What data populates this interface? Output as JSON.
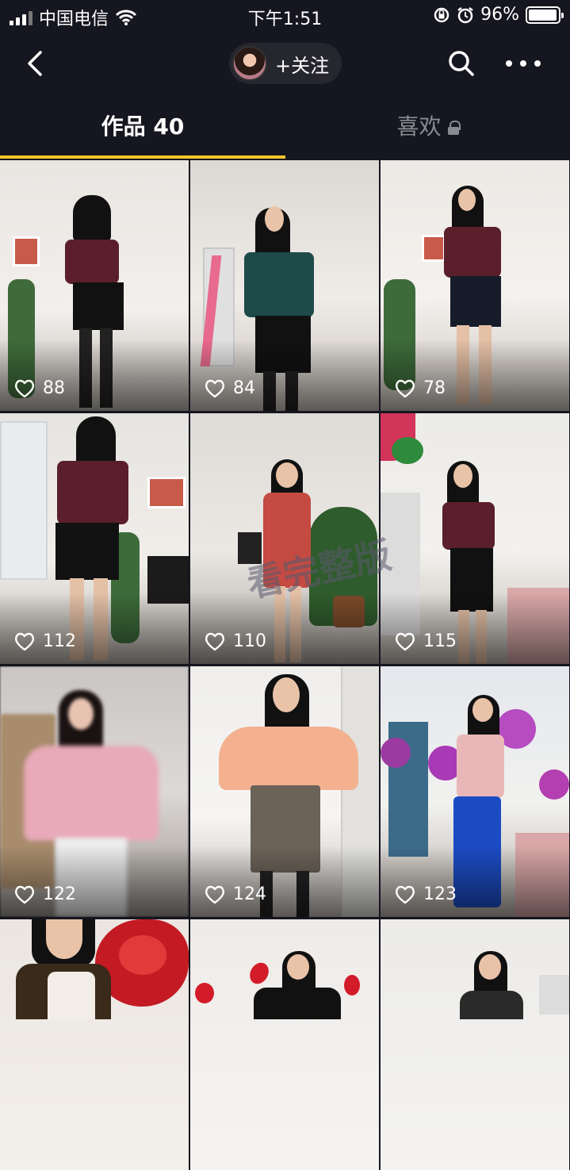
{
  "status_bar": {
    "carrier": "中国电信",
    "time": "下午1:51",
    "battery_percent": "96%",
    "battery_level": 0.96,
    "icons": [
      "signal-icon",
      "wifi-icon",
      "rotation-lock-icon",
      "alarm-icon",
      "battery-icon"
    ]
  },
  "nav": {
    "follow_label": "+关注",
    "icons": [
      "back-icon",
      "search-icon",
      "more-icon"
    ]
  },
  "tabs": {
    "works_label": "作品 40",
    "likes_label": "喜欢"
  },
  "watermark": "看完整版",
  "posts": [
    {
      "likes": "88"
    },
    {
      "likes": "84"
    },
    {
      "likes": "78"
    },
    {
      "likes": "112"
    },
    {
      "likes": "110"
    },
    {
      "likes": "115"
    },
    {
      "likes": "122"
    },
    {
      "likes": "124"
    },
    {
      "likes": "123"
    },
    {
      "likes": ""
    },
    {
      "likes": ""
    },
    {
      "likes": ""
    }
  ],
  "colors": {
    "background": "#161620",
    "tab_indicator": "#f7c52a",
    "inactive_tab": "#8a8a92"
  }
}
